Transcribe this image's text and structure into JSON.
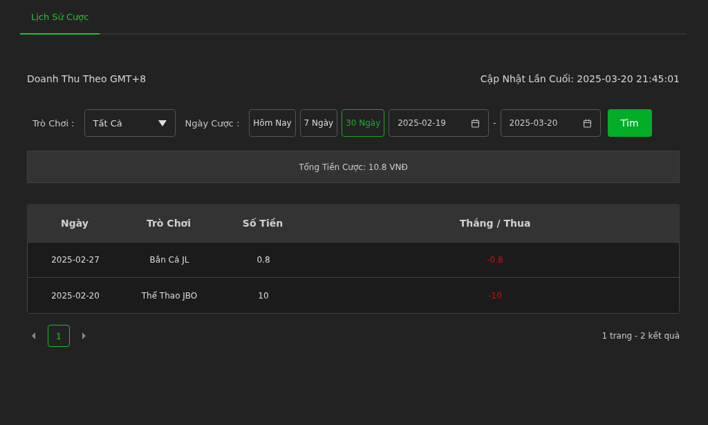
{
  "tabs": [
    {
      "label": "Lịch Sử Cược",
      "selected": true
    }
  ],
  "header": {
    "title": "Doanh Thu Theo GMT+8",
    "updated": "Cập Nhật Lần Cuối: 2025-03-20 21:45:01"
  },
  "filters": {
    "game_label": "Trò Chơi :",
    "game_value": "Tất Cả",
    "date_label": "Ngày Cược :",
    "ranges": [
      {
        "label": "Hôm Nay",
        "selected": false
      },
      {
        "label": "7 Ngày",
        "selected": false
      },
      {
        "label": "30 Ngày",
        "selected": true
      }
    ],
    "date_from": "2025-02-19",
    "separator": "-",
    "date_to": "2025-03-20",
    "search_button": "Tìm"
  },
  "summary": "Tổng Tiền Cược: 10.8 VNĐ",
  "table": {
    "columns": [
      "Ngày",
      "Trò Chơi",
      "Số Tiền",
      "Thắng / Thua"
    ],
    "rows": [
      {
        "cells": [
          "2025-02-27",
          "Bắn Cá JL",
          "0.8",
          "-0.8"
        ],
        "loss": true
      },
      {
        "cells": [
          "2025-02-20",
          "Thể Thao JBO",
          "10",
          "-10"
        ],
        "loss": true
      }
    ]
  },
  "pagination": {
    "pages": [
      {
        "label": "1",
        "selected": true
      }
    ],
    "info": "1 trang - 2 kết quả"
  }
}
